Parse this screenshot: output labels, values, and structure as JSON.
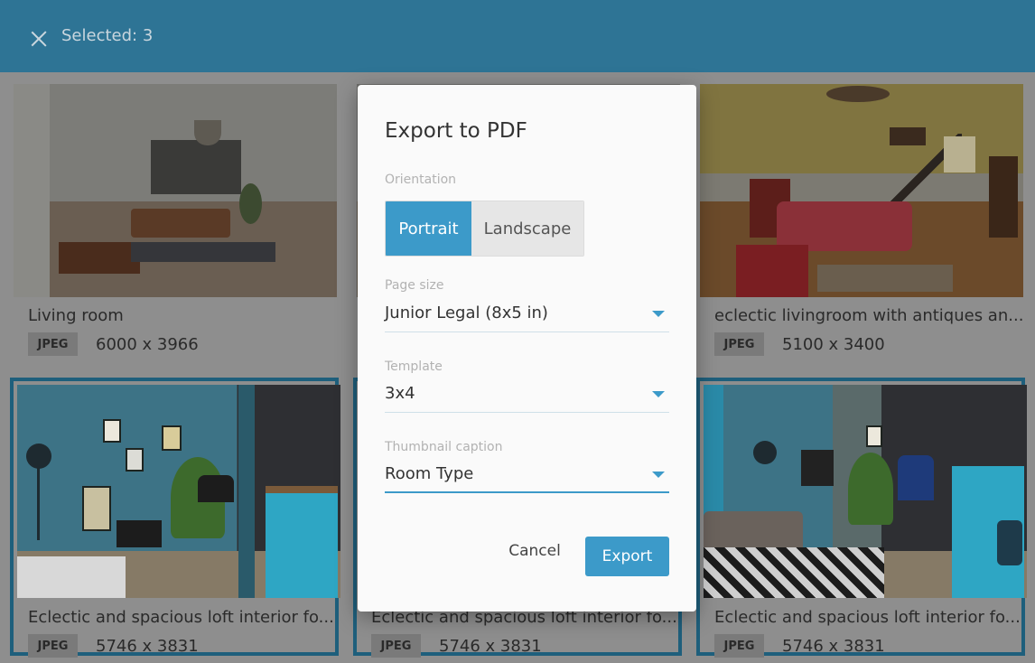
{
  "header": {
    "selected_label": "Selected: 3"
  },
  "cards": [
    {
      "title": "Living room",
      "format": "JPEG",
      "dimensions": "6000 x 3966",
      "selected": false
    },
    {
      "title": "",
      "format": "",
      "dimensions": "",
      "selected": false
    },
    {
      "title": "eclectic livingroom with antiques an...",
      "format": "JPEG",
      "dimensions": "5100 x 3400",
      "selected": false
    },
    {
      "title": "Eclectic and spacious loft interior fo...",
      "format": "JPEG",
      "dimensions": "5746 x 3831",
      "selected": true
    },
    {
      "title": "Eclectic and spacious loft interior fo...",
      "format": "JPEG",
      "dimensions": "5746 x 3831",
      "selected": true
    },
    {
      "title": "Eclectic and spacious loft interior fo...",
      "format": "JPEG",
      "dimensions": "5746 x 3831",
      "selected": true
    }
  ],
  "dialog": {
    "title": "Export to PDF",
    "orientation_label": "Orientation",
    "orientation_options": [
      "Portrait",
      "Landscape"
    ],
    "orientation_selected": "Portrait",
    "page_size_label": "Page size",
    "page_size_value": "Junior Legal (8x5 in)",
    "template_label": "Template",
    "template_value": "3x4",
    "caption_label": "Thumbnail caption",
    "caption_value": "Room Type",
    "cancel_label": "Cancel",
    "export_label": "Export"
  },
  "colors": {
    "header": "#2e7495",
    "accent": "#3c9ac9",
    "selected_border": "#1e5f7c"
  }
}
